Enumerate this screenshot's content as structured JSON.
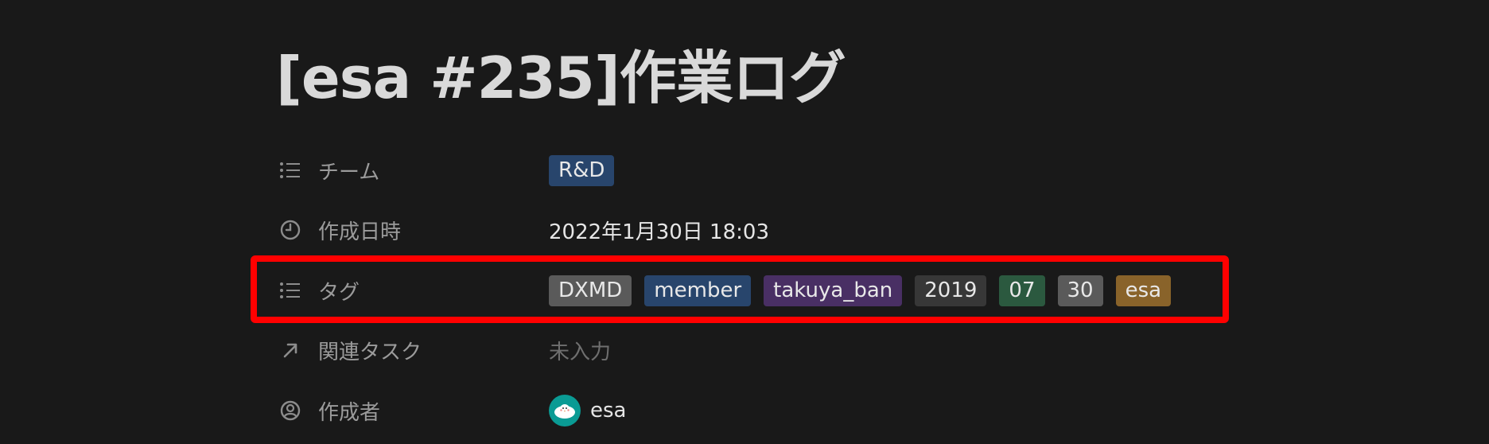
{
  "page": {
    "title": "[esa #235]作業ログ"
  },
  "properties": {
    "team": {
      "name": "チーム",
      "icon": "list-icon",
      "tag": {
        "label": "R&D",
        "color": "#28456c"
      }
    },
    "created_time": {
      "name": "作成日時",
      "icon": "clock-icon",
      "value": "2022年1月30日 18:03"
    },
    "tags": {
      "name": "タグ",
      "icon": "list-icon",
      "items": [
        {
          "label": "DXMD",
          "color": "#5a5a5a"
        },
        {
          "label": "member",
          "color": "#28456c"
        },
        {
          "label": "takuya_ban",
          "color": "#492f64"
        },
        {
          "label": "2019",
          "color": "#373737"
        },
        {
          "label": "07",
          "color": "#2b593f"
        },
        {
          "label": "30",
          "color": "#5a5a5a"
        },
        {
          "label": "esa",
          "color": "#89632a"
        }
      ]
    },
    "related_task": {
      "name": "関連タスク",
      "icon": "arrow-up-right-icon",
      "value": "未入力"
    },
    "creator": {
      "name": "作成者",
      "icon": "person-circle-icon",
      "value": "esa",
      "avatar_icon": "esa-avatar-icon"
    }
  },
  "highlight_color": "#ff0000"
}
